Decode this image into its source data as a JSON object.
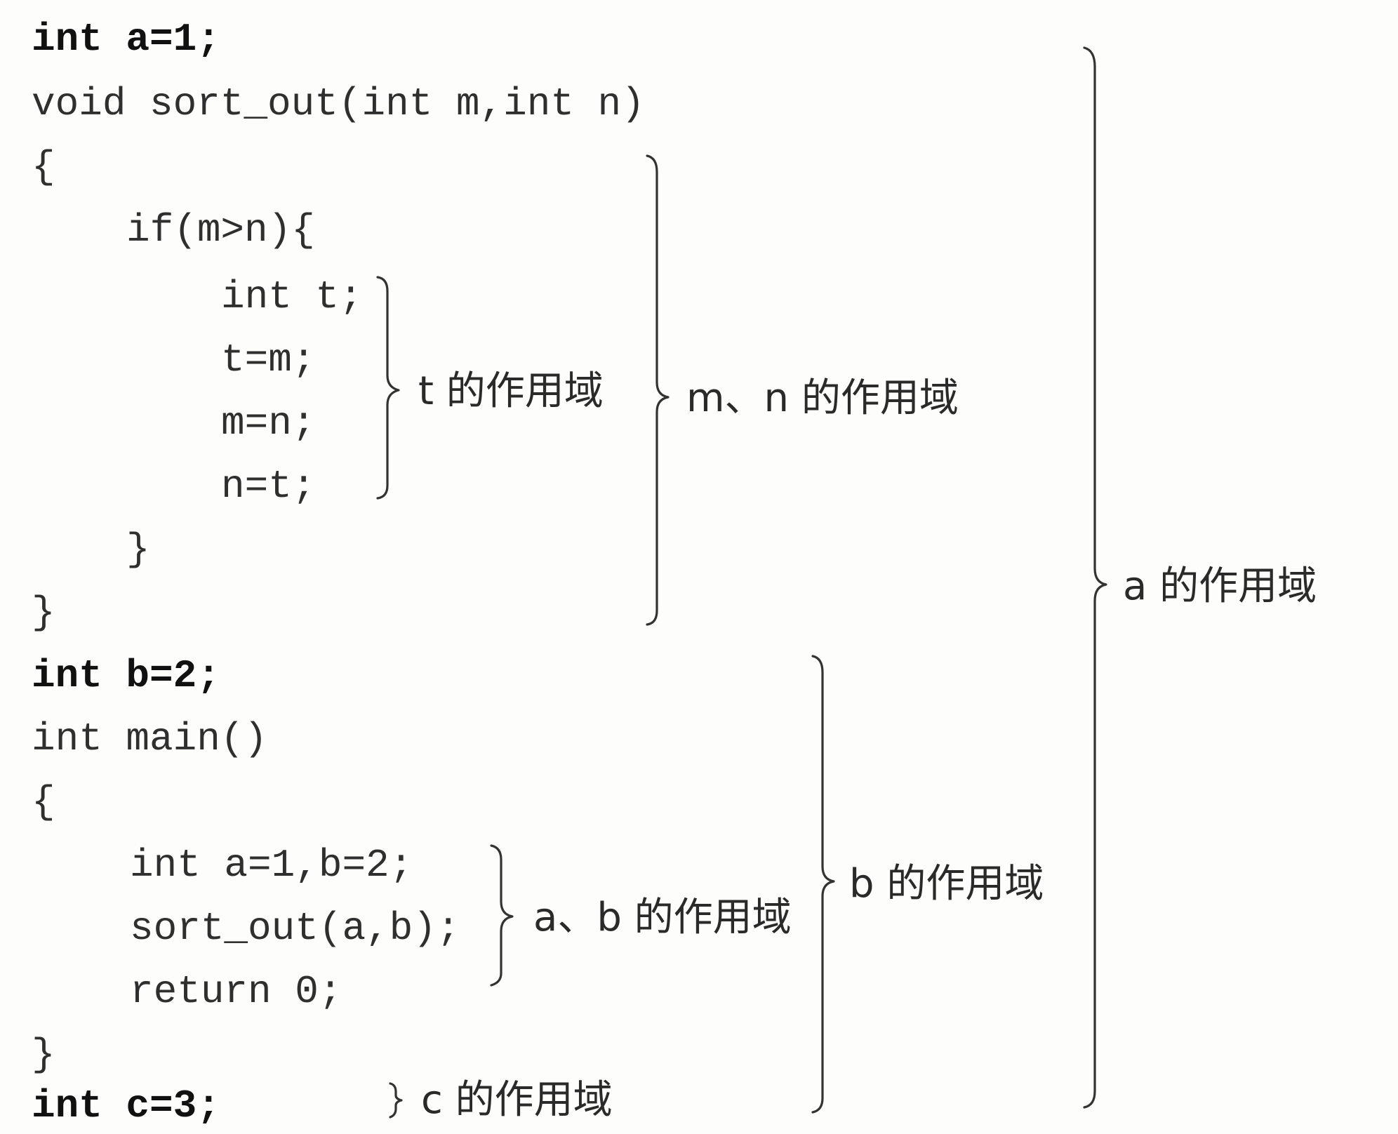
{
  "code_lines": [
    "int a=1;",
    "void sort_out(int m,int n)",
    "{",
    "if(m>n){",
    "int t;",
    "t=m;",
    "m=n;",
    "n=t;",
    "}",
    "}",
    "int b=2;",
    "int main()",
    "{",
    "int a=1,b=2;",
    "sort_out(a,b);",
    "return 0;",
    "}",
    "int c=3;"
  ],
  "scope_labels": {
    "t": "t 的作用域",
    "mn": "m、n 的作用域",
    "a": "a 的作用域",
    "ab": "a、b 的作用域",
    "b": "b 的作用域",
    "c": "c 的作用域"
  }
}
